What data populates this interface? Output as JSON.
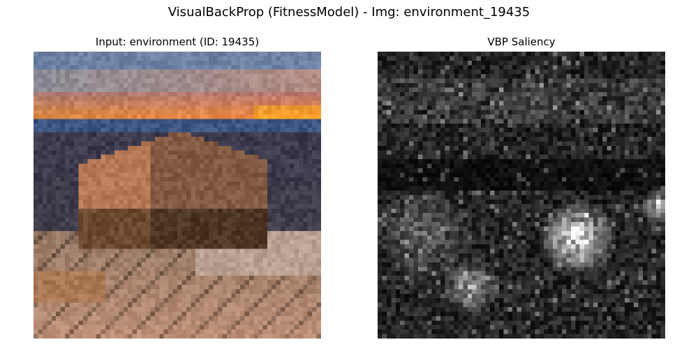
{
  "figure": {
    "suptitle": "VisualBackProp (FitnessModel) - Img: environment_19435"
  },
  "panels": {
    "input": {
      "title": "Input: environment (ID: 19435)",
      "image_description": "pixelated canyon landscape at sunset"
    },
    "saliency": {
      "title": "VBP Saliency",
      "colormap": "gray"
    }
  },
  "colors": {
    "background": "#ffffff",
    "text": "#000000",
    "saliency_low": "#000000",
    "saliency_high": "#ffffff",
    "sunset_orange": "#d88a50",
    "sky_blue": "#5a7ca8",
    "rock_tan": "#b08a6a",
    "shadow_brown": "#3a2e2a"
  }
}
